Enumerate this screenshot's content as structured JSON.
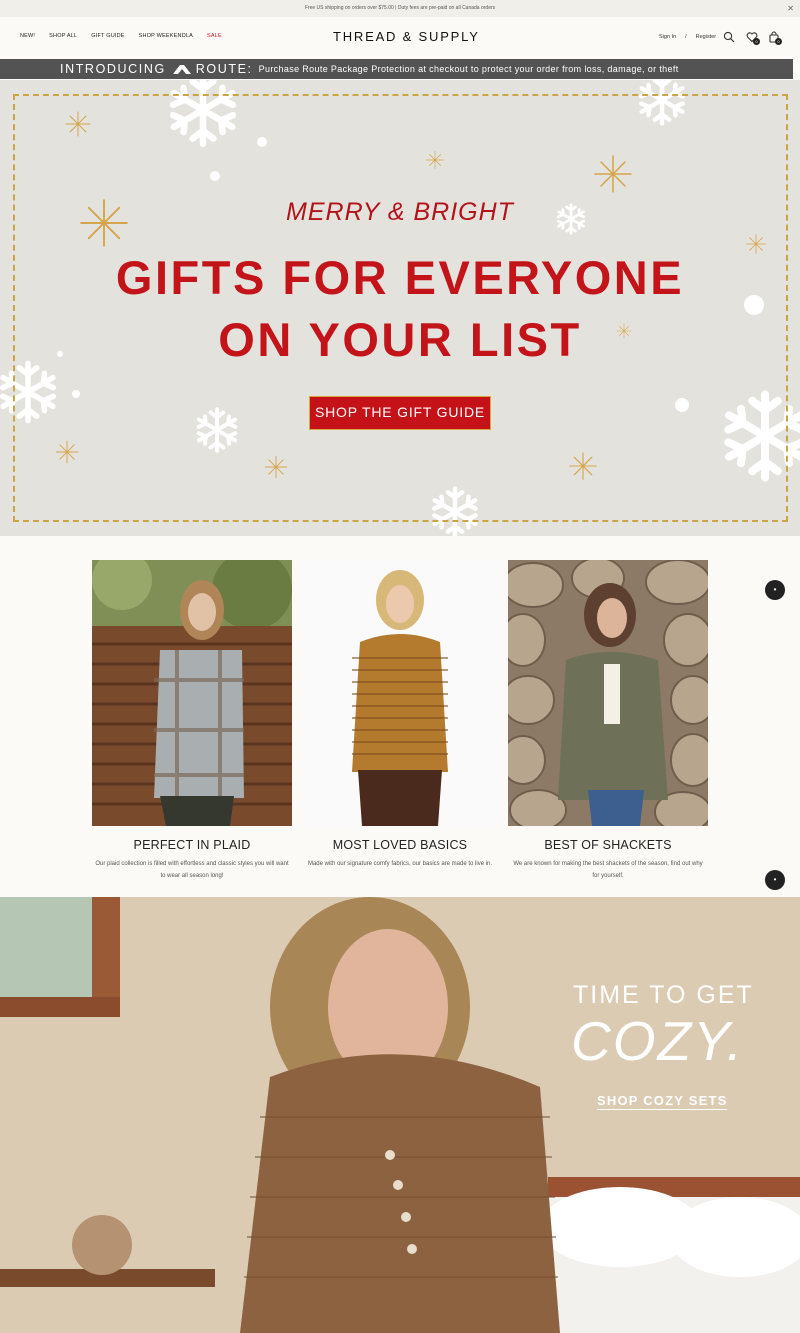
{
  "announcement": {
    "text": "Free US shipping on orders over $75.00  |  Duty fees are pre-paid on all Canada orders",
    "close_icon": "close-icon"
  },
  "header": {
    "nav": [
      {
        "label": "NEW!"
      },
      {
        "label": "SHOP ALL"
      },
      {
        "label": "GIFT GUIDE"
      },
      {
        "label": "SHOP WEEKENDLA"
      },
      {
        "label": "SALE",
        "color": "#c0151d"
      }
    ],
    "logo": "THREAD & SUPPLY",
    "sign_in": "Sign In",
    "separator": "/",
    "register": "Register",
    "wishlist_count": "0",
    "cart_count": "0",
    "icons": [
      "search-icon",
      "heart-icon",
      "bag-icon"
    ]
  },
  "route_banner": {
    "introducing": "INTRODUCING",
    "brand": "ROUTE:",
    "message": "Purchase Route Package Protection at checkout to protect your order from loss, damage, or theft"
  },
  "hero": {
    "kicker": "MERRY & BRIGHT",
    "title_line1": "GIFTS FOR EVERYONE",
    "title_line2": "ON YOUR LIST",
    "cta": "SHOP THE GIFT GUIDE",
    "accent": "#c3141a",
    "frame_color": "#c9a548"
  },
  "categories": [
    {
      "title": "PERFECT IN PLAID",
      "desc": "Our plaid collection is filled with effortless and classic styles you will want to wear all season long!"
    },
    {
      "title": "MOST LOVED BASICS",
      "desc": "Made with our signature comfy fabrics, our basics are made to live in."
    },
    {
      "title": "BEST OF SHACKETS",
      "desc": "We are known for making the best shackets of the season, find out why for yourself."
    }
  ],
  "cozy": {
    "line1": "TIME TO GET",
    "line2": "COZY.",
    "cta": "SHOP COZY SETS"
  }
}
